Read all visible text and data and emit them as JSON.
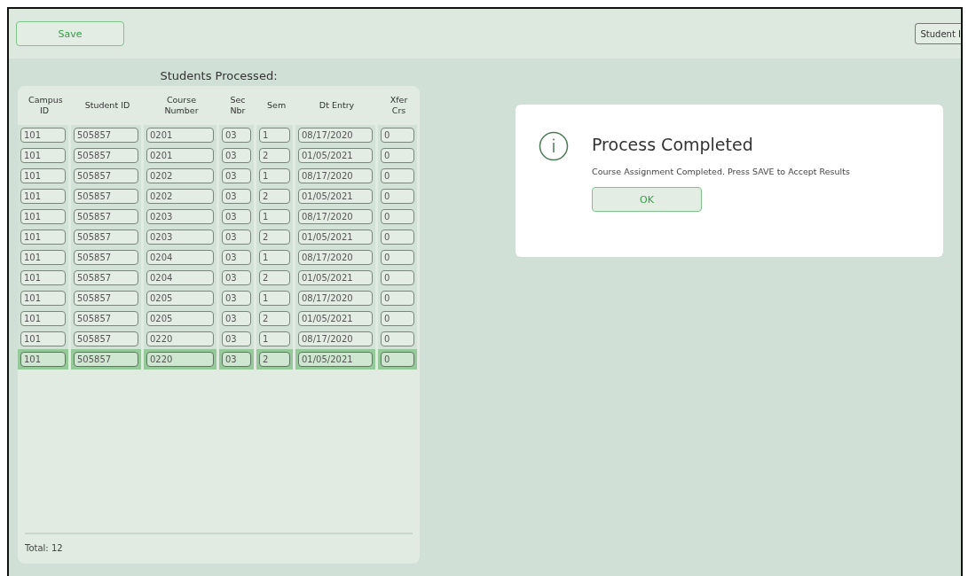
{
  "toolbar": {
    "save_button": "Save",
    "student_button": "Student I"
  },
  "table": {
    "title": "Students Processed:",
    "columns": [
      "Campus ID",
      "Student ID",
      "Course Number",
      "Sec Nbr",
      "Sem",
      "Dt Entry",
      "Xfer Crs"
    ],
    "rows": [
      {
        "cells": [
          "101",
          "505857",
          "0201",
          "03",
          "1",
          "08/17/2020",
          "0"
        ],
        "selected": false
      },
      {
        "cells": [
          "101",
          "505857",
          "0201",
          "03",
          "2",
          "01/05/2021",
          "0"
        ],
        "selected": false
      },
      {
        "cells": [
          "101",
          "505857",
          "0202",
          "03",
          "1",
          "08/17/2020",
          "0"
        ],
        "selected": false
      },
      {
        "cells": [
          "101",
          "505857",
          "0202",
          "03",
          "2",
          "01/05/2021",
          "0"
        ],
        "selected": false
      },
      {
        "cells": [
          "101",
          "505857",
          "0203",
          "03",
          "1",
          "08/17/2020",
          "0"
        ],
        "selected": false
      },
      {
        "cells": [
          "101",
          "505857",
          "0203",
          "03",
          "2",
          "01/05/2021",
          "0"
        ],
        "selected": false
      },
      {
        "cells": [
          "101",
          "505857",
          "0204",
          "03",
          "1",
          "08/17/2020",
          "0"
        ],
        "selected": false
      },
      {
        "cells": [
          "101",
          "505857",
          "0204",
          "03",
          "2",
          "01/05/2021",
          "0"
        ],
        "selected": false
      },
      {
        "cells": [
          "101",
          "505857",
          "0205",
          "03",
          "1",
          "08/17/2020",
          "0"
        ],
        "selected": false
      },
      {
        "cells": [
          "101",
          "505857",
          "0205",
          "03",
          "2",
          "01/05/2021",
          "0"
        ],
        "selected": false
      },
      {
        "cells": [
          "101",
          "505857",
          "0220",
          "03",
          "1",
          "08/17/2020",
          "0"
        ],
        "selected": false
      },
      {
        "cells": [
          "101",
          "505857",
          "0220",
          "03",
          "2",
          "01/05/2021",
          "0"
        ],
        "selected": true
      }
    ],
    "total": "Total: 12"
  },
  "dialog": {
    "title": "Process Completed",
    "message": "Course Assignment Completed. Press SAVE to Accept Results",
    "ok_button": "OK"
  }
}
